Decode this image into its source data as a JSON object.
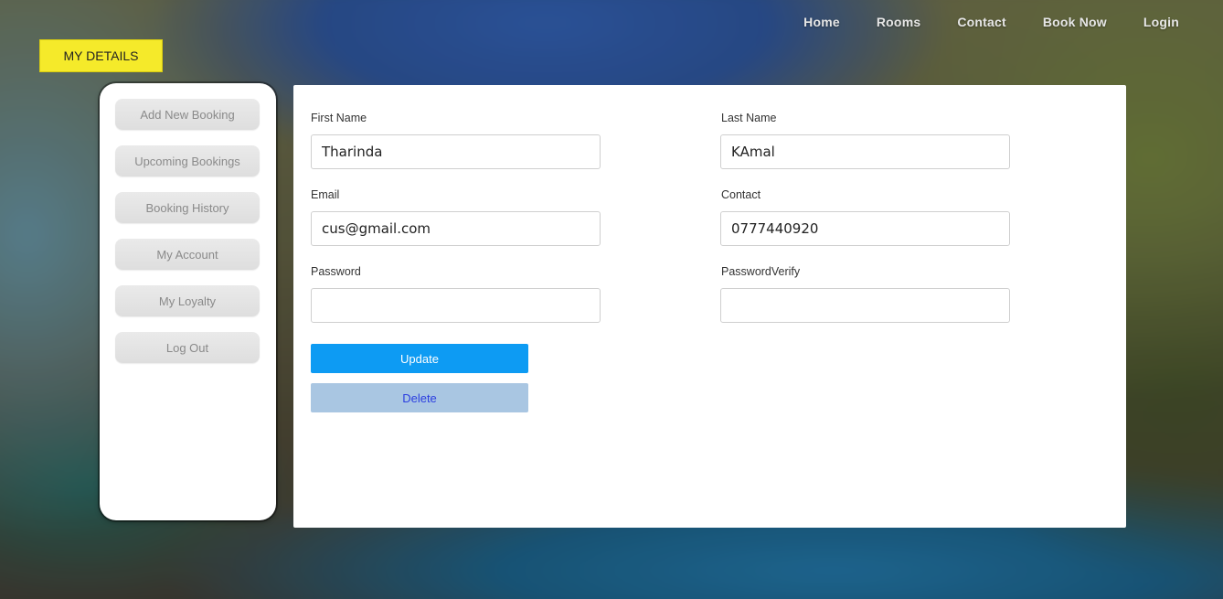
{
  "nav": {
    "items": [
      {
        "label": "Home"
      },
      {
        "label": "Rooms"
      },
      {
        "label": "Contact"
      },
      {
        "label": "Book Now"
      },
      {
        "label": "Login"
      }
    ]
  },
  "section_badge": "MY DETAILS",
  "sidebar": {
    "items": [
      {
        "label": "Add New Booking"
      },
      {
        "label": "Upcoming Bookings"
      },
      {
        "label": "Booking History"
      },
      {
        "label": "My Account"
      },
      {
        "label": "My Loyalty"
      },
      {
        "label": "Log Out"
      }
    ]
  },
  "form": {
    "first_name": {
      "label": "First Name",
      "value": "Tharinda"
    },
    "last_name": {
      "label": "Last Name",
      "value": "KAmal"
    },
    "email": {
      "label": "Email",
      "value": "cus@gmail.com"
    },
    "contact": {
      "label": "Contact",
      "value": "0777440920"
    },
    "password": {
      "label": "Password",
      "value": ""
    },
    "password_verify": {
      "label": "PasswordVerify",
      "value": ""
    },
    "update_label": "Update",
    "delete_label": "Delete"
  },
  "colors": {
    "badge": "#f5ea2a",
    "update_button": "#0d9bf3",
    "delete_button": "#a9c6e2",
    "delete_text": "#2b3ee0"
  }
}
